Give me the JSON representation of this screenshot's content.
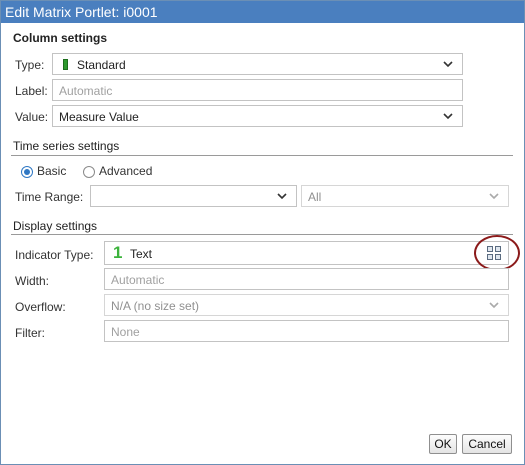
{
  "dialog": {
    "title": "Edit Matrix Portlet: i0001",
    "ok_label": "OK",
    "cancel_label": "Cancel"
  },
  "column_settings": {
    "heading": "Column settings",
    "type_label": "Type:",
    "type_value": "Standard",
    "label_label": "Label:",
    "label_placeholder": "Automatic",
    "value_label": "Value:",
    "value_value": "Measure Value"
  },
  "time_series": {
    "heading": "Time series settings",
    "basic_label": "Basic",
    "advanced_label": "Advanced",
    "selected": "Basic",
    "time_range_label": "Time Range:",
    "time_range_value": "",
    "secondary_value": "All"
  },
  "display_settings": {
    "heading": "Display settings",
    "indicator_type_label": "Indicator Type:",
    "indicator_glyph": "1",
    "indicator_value": "Text",
    "width_label": "Width:",
    "width_placeholder": "Automatic",
    "overflow_label": "Overflow:",
    "overflow_value": "N/A (no size set)",
    "filter_label": "Filter:",
    "filter_placeholder": "None"
  },
  "colors": {
    "titlebar": "#4a7fbf",
    "accent": "#2f78c4",
    "standard_icon": "#2e9a2e",
    "indicator_glyph": "#3cb33c",
    "highlight_circle": "#8b1a1a"
  }
}
